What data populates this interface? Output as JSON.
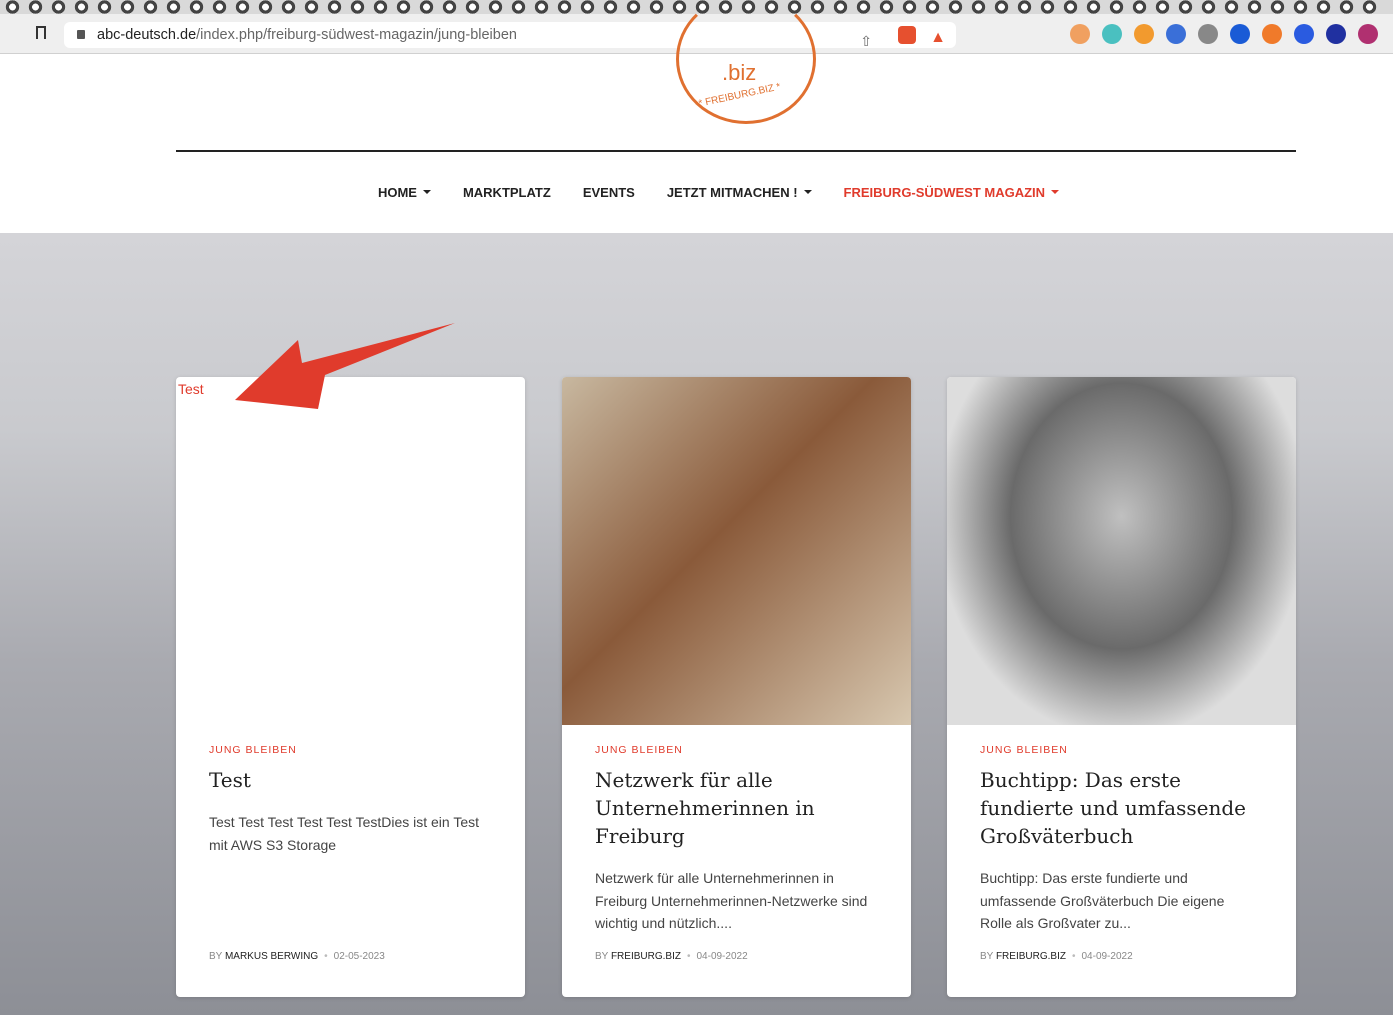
{
  "browser": {
    "url_domain": "abc-deutsch.de",
    "url_path": "/index.php/freiburg-südwest-magazin/jung-bleiben",
    "shield_count": "15"
  },
  "logo": {
    "text": ".biz",
    "ring_text": "* FREIBURG.BIZ *"
  },
  "nav": [
    {
      "label": "HOME",
      "caret": true
    },
    {
      "label": "MARKTPLATZ"
    },
    {
      "label": "EVENTS"
    },
    {
      "label": "JETZT MITMACHEN !",
      "caret": true
    },
    {
      "label": "FREIBURG-SÜDWEST MAGAZIN",
      "caret": true,
      "active": true
    }
  ],
  "cards": [
    {
      "image_alt": "Test",
      "category": "JUNG BLEIBEN",
      "title": "Test",
      "excerpt": "Test Test Test Test Test TestDies ist ein Test mit AWS S3 Storage",
      "by": "BY",
      "author": "MARKUS BERWING",
      "date": "02-05-2023"
    },
    {
      "category": "JUNG BLEIBEN",
      "title": "Netzwerk für alle Unternehmerinnen in Freiburg",
      "excerpt": "Netzwerk für alle Unternehmerinnen in Freiburg Unternehmerinnen-Netzwerke sind wichtig und nützlich....",
      "by": "BY",
      "author": "FREIBURG.BIZ",
      "date": "04-09-2022"
    },
    {
      "category": "JUNG BLEIBEN",
      "title": "Buchtipp: Das erste fundierte und umfassende Großväterbuch",
      "excerpt": "Buchtipp: Das erste fundierte und umfassende Großväterbuch Die eigene Rolle als Großvater zu...",
      "by": "BY",
      "author": "FREIBURG.BIZ",
      "date": "04-09-2022"
    }
  ]
}
